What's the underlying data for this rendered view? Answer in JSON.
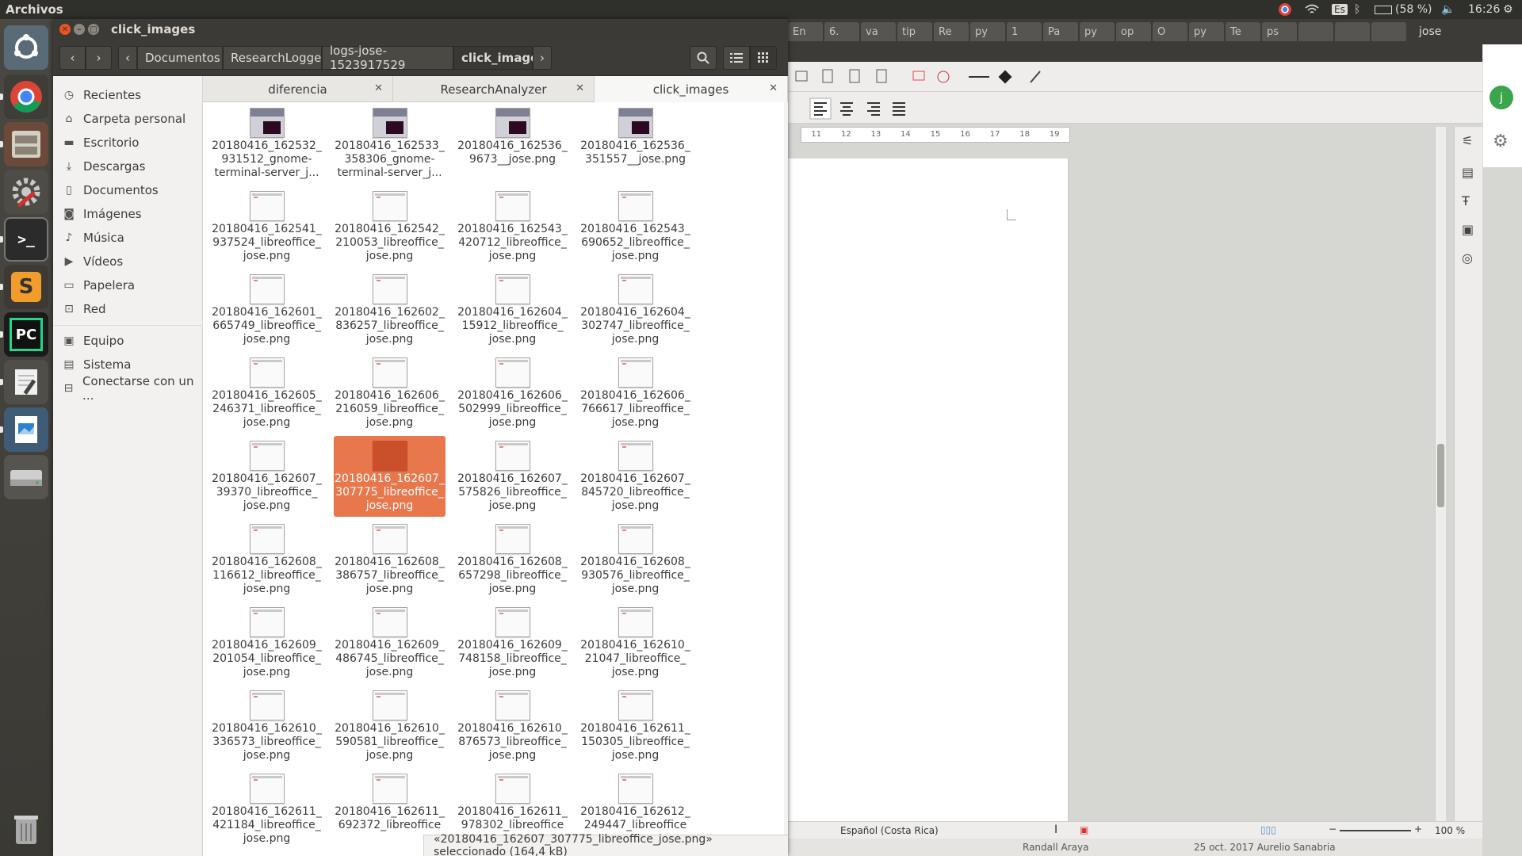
{
  "top_panel": {
    "app_name": "Archivos",
    "keyboard": "Es",
    "battery": "(58 %)",
    "time": "16:26",
    "user": "jose"
  },
  "chrome_tabs": [
    "En",
    "6.",
    "va",
    "tip",
    "Re",
    "py",
    "1",
    "Pa",
    "py",
    "op",
    "O",
    "py",
    "Te",
    "ps",
    "",
    "",
    ""
  ],
  "window": {
    "title": "click_images"
  },
  "breadcrumbs": [
    "Documentos",
    "ResearchLogger",
    "logs-jose-1523917529",
    "click_images"
  ],
  "sidebar": {
    "items": [
      {
        "label": "Recientes",
        "icon": "clock-icon"
      },
      {
        "label": "Carpeta personal",
        "icon": "home-icon"
      },
      {
        "label": "Escritorio",
        "icon": "folder-icon"
      },
      {
        "label": "Descargas",
        "icon": "download-icon"
      },
      {
        "label": "Documentos",
        "icon": "document-icon"
      },
      {
        "label": "Imágenes",
        "icon": "camera-icon"
      },
      {
        "label": "Música",
        "icon": "music-icon"
      },
      {
        "label": "Vídeos",
        "icon": "video-icon"
      },
      {
        "label": "Papelera",
        "icon": "trash-icon"
      },
      {
        "label": "Red",
        "icon": "network-icon"
      },
      {
        "label": "Equipo",
        "icon": "computer-icon"
      },
      {
        "label": "Sistema",
        "icon": "drive-icon"
      },
      {
        "label": "Conectarse con un ...",
        "icon": "server-icon"
      }
    ]
  },
  "tabs": [
    "diferencia",
    "ResearchAnalyzer",
    "click_images"
  ],
  "files": [
    "20180416_162532_\n931512_gnome-\nterminal-server_j...",
    "20180416_162533_\n358306_gnome-\nterminal-server_j...",
    "20180416_162536_\n9673__jose.png",
    "20180416_162536_\n351557__jose.png",
    "20180416_162541_\n937524_libreoffice_\njose.png",
    "20180416_162542_\n210053_libreoffice_\njose.png",
    "20180416_162543_\n420712_libreoffice_\njose.png",
    "20180416_162543_\n690652_libreoffice_\njose.png",
    "20180416_162601_\n665749_libreoffice_\njose.png",
    "20180416_162602_\n836257_libreoffice_\njose.png",
    "20180416_162604_\n15912_libreoffice_\njose.png",
    "20180416_162604_\n302747_libreoffice_\njose.png",
    "20180416_162605_\n246371_libreoffice_\njose.png",
    "20180416_162606_\n216059_libreoffice_\njose.png",
    "20180416_162606_\n502999_libreoffice_\njose.png",
    "20180416_162606_\n766617_libreoffice_\njose.png",
    "20180416_162607_\n39370_libreoffice_\njose.png",
    "20180416_162607_\n307775_libreoffice_\njose.png",
    "20180416_162607_\n575826_libreoffice_\njose.png",
    "20180416_162607_\n845720_libreoffice_\njose.png",
    "20180416_162608_\n116612_libreoffice_\njose.png",
    "20180416_162608_\n386757_libreoffice_\njose.png",
    "20180416_162608_\n657298_libreoffice_\njose.png",
    "20180416_162608_\n930576_libreoffice_\njose.png",
    "20180416_162609_\n201054_libreoffice_\njose.png",
    "20180416_162609_\n486745_libreoffice_\njose.png",
    "20180416_162609_\n748158_libreoffice_\njose.png",
    "20180416_162610_\n21047_libreoffice_\njose.png",
    "20180416_162610_\n336573_libreoffice_\njose.png",
    "20180416_162610_\n590581_libreoffice_\njose.png",
    "20180416_162610_\n876573_libreoffice_\njose.png",
    "20180416_162611_\n150305_libreoffice_\njose.png",
    "20180416_162611_\n421184_libreoffice_\njose.png",
    "20180416_162611_\n692372_libreoffice",
    "20180416_162611_\n978302_libreoffice",
    "20180416_162612_\n249447_libreoffice"
  ],
  "selected_index": 17,
  "status_text": "«20180416_162607_307775_libreoffice_jose.png» seleccionado  (164,4 kB)",
  "libreoffice": {
    "ruler_marks": [
      "11",
      "12",
      "13",
      "14",
      "15",
      "16",
      "17",
      "18",
      "19"
    ],
    "language": "Español (Costa Rica)",
    "zoom": "100 %",
    "footer_author": "Randall Araya",
    "footer_date": "25 oct. 2017  Aurelio Sanabria"
  },
  "colors": {
    "selection": "#e9774c",
    "panel": "#2f2f2b",
    "headerbar": "#3c3b37"
  }
}
